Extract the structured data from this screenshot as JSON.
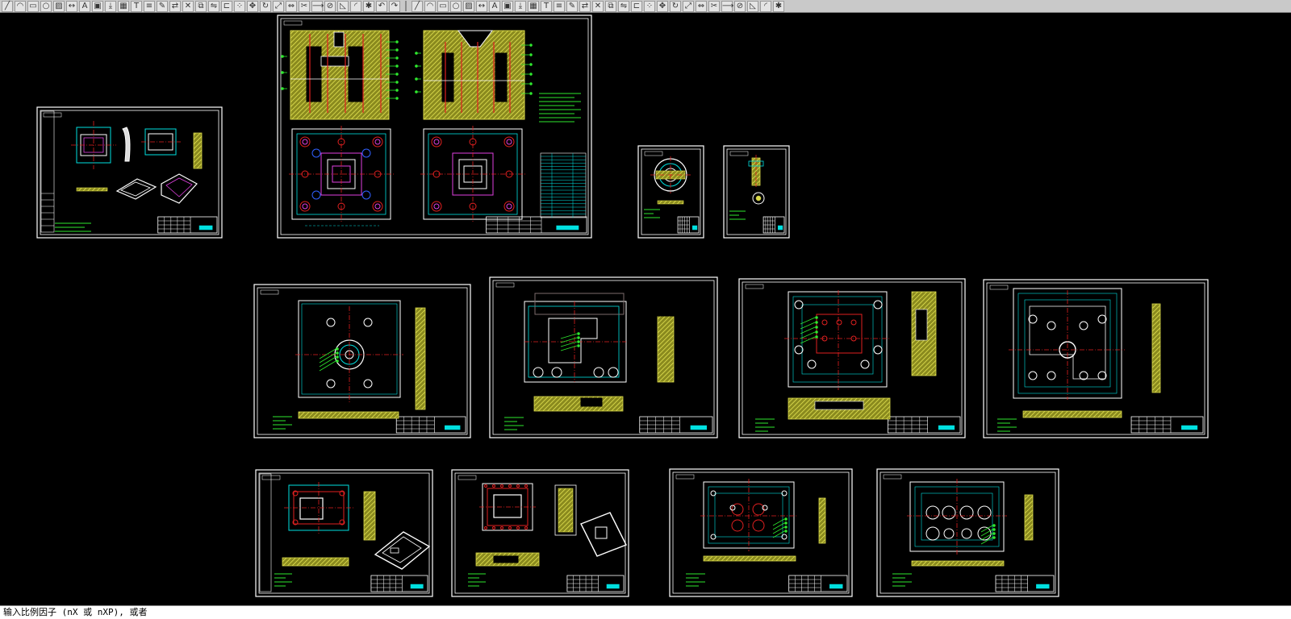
{
  "app": {
    "toolbar_icons": [
      "line-icon",
      "arc-icon",
      "rectangle-icon",
      "circle-icon",
      "hatch-icon",
      "dimension-icon",
      "text-icon",
      "block-icon",
      "insert-icon",
      "table-icon",
      "mtext-icon",
      "layer-icon",
      "properties-icon",
      "match-icon",
      "erase-icon",
      "copy-icon",
      "mirror-icon",
      "offset-icon",
      "array-icon",
      "move-icon",
      "rotate-icon",
      "scale-icon",
      "stretch-icon",
      "trim-icon",
      "extend-icon",
      "break-icon",
      "chamfer-icon",
      "fillet-icon",
      "explode-icon",
      "undo-icon",
      "redo-icon",
      "pan-icon",
      "zoom-icon",
      "zoom-window-icon",
      "zoom-prev-icon",
      "redraw-icon",
      "regen-icon",
      "snap-icon",
      "grid-icon",
      "ortho-icon",
      "polar-icon",
      "osnap-icon",
      "otrack-icon",
      "lwt-icon",
      "model-icon",
      "layout-icon",
      "plot-icon",
      "preview-icon",
      "publish-icon",
      "dist-icon",
      "area-icon",
      "list-icon",
      "id-icon",
      "calc-icon",
      "design-center-icon",
      "tool-palette-icon",
      "sheet-set-icon",
      "markup-icon",
      "qcalc-icon",
      "help-icon"
    ],
    "command_line": "输入比例因子 (nX 或 nXP), 或者"
  },
  "colors": {
    "background": "#000000",
    "frame": "#ffffff",
    "hatch": "#d9d94a",
    "cyan": "#00e0e0",
    "green": "#2ee82e",
    "red": "#e02020",
    "magenta": "#e040e0",
    "blue": "#3060ff"
  },
  "sheets": [
    {
      "id": "product-drawing",
      "kind": "product"
    },
    {
      "id": "mold-assembly",
      "kind": "assembly"
    },
    {
      "id": "locating-ring",
      "kind": "small-round"
    },
    {
      "id": "sprue-bushing",
      "kind": "small-round"
    },
    {
      "id": "top-clamp-plate",
      "kind": "plate-round"
    },
    {
      "id": "cavity-plate",
      "kind": "plate-cavity"
    },
    {
      "id": "core-plate",
      "kind": "plate-core"
    },
    {
      "id": "ejector-retainer",
      "kind": "plate-frame"
    },
    {
      "id": "cavity-insert",
      "kind": "insert-iso"
    },
    {
      "id": "core-insert",
      "kind": "insert-iso"
    },
    {
      "id": "support-plate",
      "kind": "plate-holes"
    },
    {
      "id": "bottom-clamp-plate",
      "kind": "plate-holes"
    }
  ]
}
